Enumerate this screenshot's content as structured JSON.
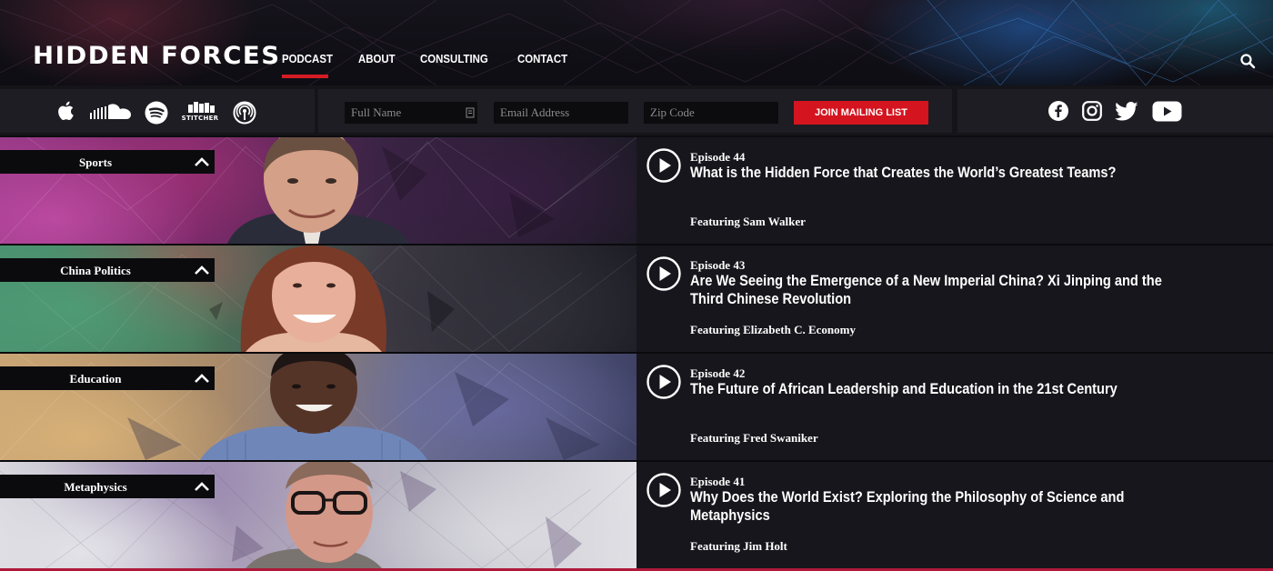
{
  "header": {
    "logo": "HIDDEN FORCES",
    "nav": [
      "PODCAST",
      "ABOUT",
      "CONSULTING",
      "CONTACT"
    ],
    "active_nav": "PODCAST"
  },
  "toolbar": {
    "platforms": [
      "apple-podcasts-icon",
      "soundcloud-icon",
      "spotify-icon",
      "stitcher-icon",
      "podcast-rss-icon"
    ],
    "stitcher_label": "STITCHER",
    "form": {
      "name_placeholder": "Full Name",
      "email_placeholder": "Email Address",
      "zip_placeholder": "Zip Code",
      "join_label": "JOIN MAILING LIST"
    },
    "social": [
      "facebook-icon",
      "instagram-icon",
      "twitter-icon",
      "youtube-icon"
    ]
  },
  "episodes": [
    {
      "category": "Sports",
      "number": "Episode 44",
      "title": "What is the Hidden Force that Creates the World’s Greatest Teams?",
      "featuring": "Featuring Sam Walker"
    },
    {
      "category": "China Politics",
      "number": "Episode 43",
      "title": "Are We Seeing the Emergence of a New Imperial China? Xi Jinping and the Third Chinese Revolution",
      "featuring": "Featuring Elizabeth C. Economy"
    },
    {
      "category": "Education",
      "number": "Episode 42",
      "title": "The Future of African Leadership and Education in the 21st Century",
      "featuring": "Featuring Fred Swaniker"
    },
    {
      "category": "Metaphysics",
      "number": "Episode 41",
      "title": "Why Does the World Exist? Exploring the Philosophy of Science and Metaphysics",
      "featuring": "Featuring Jim Holt"
    }
  ],
  "colors": {
    "accent": "#d4141f",
    "background": "#0c0c11",
    "panel": "#17161c"
  }
}
